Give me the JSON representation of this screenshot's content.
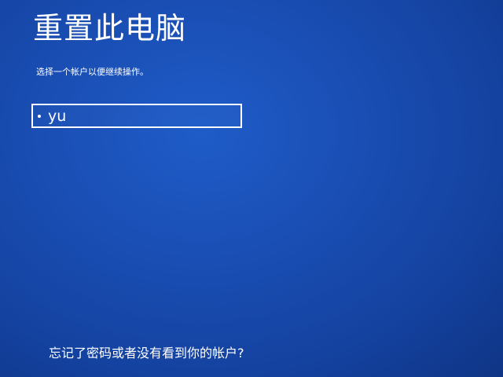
{
  "header": {
    "title": "重置此电脑",
    "subtitle": "选择一个帐户以便继续操作。"
  },
  "accounts": [
    {
      "name": "yu",
      "icon": "bullet-icon"
    }
  ],
  "footer": {
    "forgot_link": "忘记了密码或者没有看到你的帐户?"
  },
  "colors": {
    "background": "#1a4fb5",
    "text": "#ffffff",
    "tile_border": "#ffffff"
  }
}
